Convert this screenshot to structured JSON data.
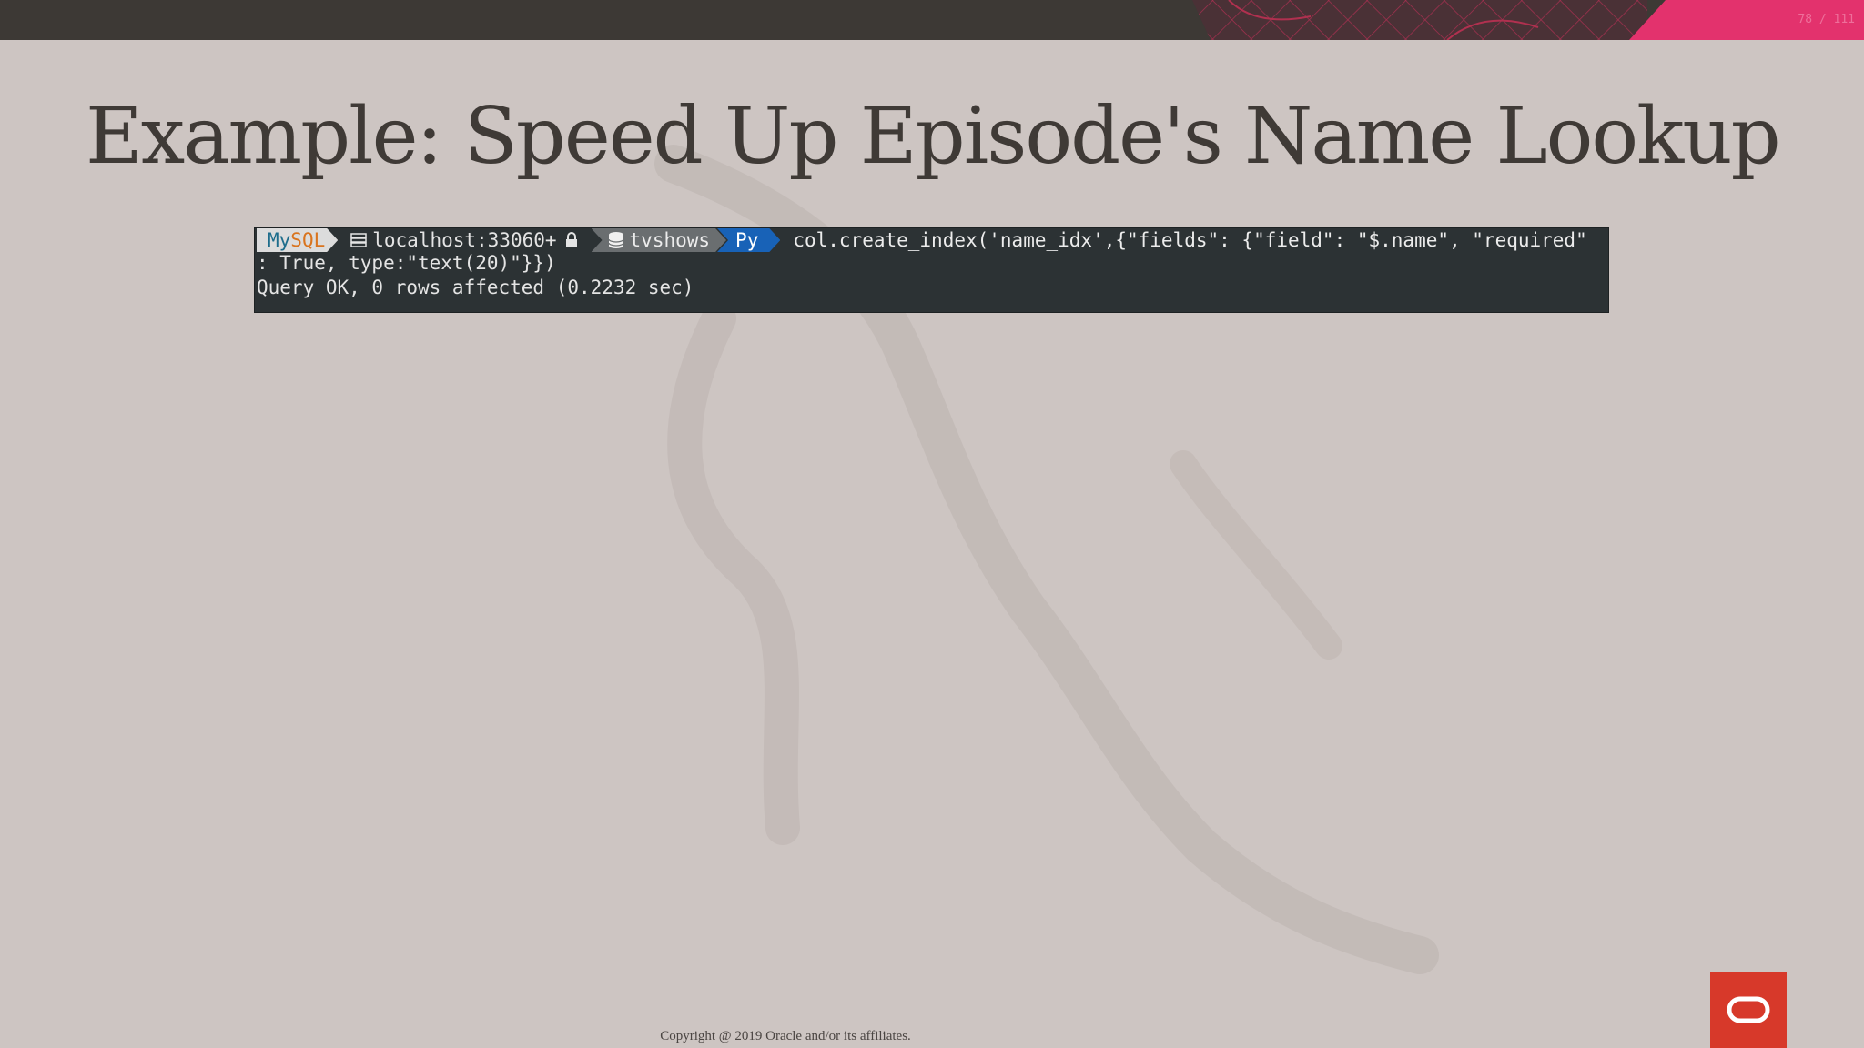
{
  "header": {
    "page_counter": "78 / 111",
    "accent_color": "#e3326d",
    "bar_color": "#3d3935"
  },
  "slide": {
    "title": "Example: Speed Up Episode's Name Lookup"
  },
  "terminal": {
    "prompt": {
      "mysql_my": "My",
      "mysql_sql": "SQL",
      "host": "localhost:33060+",
      "schema": "tvshows",
      "mode": "Py"
    },
    "command_line1": "col.create_index('name_idx',{\"fields\": {\"field\": \"$.name\", \"required\"",
    "command_line2": ": True, type:\"text(20)\"}})",
    "result": "Query OK, 0 rows affected (0.2232 sec)",
    "icons": [
      "server-icon",
      "lock-icon",
      "database-icon"
    ]
  },
  "footer": {
    "copyright": "Copyright @ 2019 Oracle and/or its affiliates.",
    "logo": "oracle-logo",
    "logo_color": "#d7392a"
  }
}
